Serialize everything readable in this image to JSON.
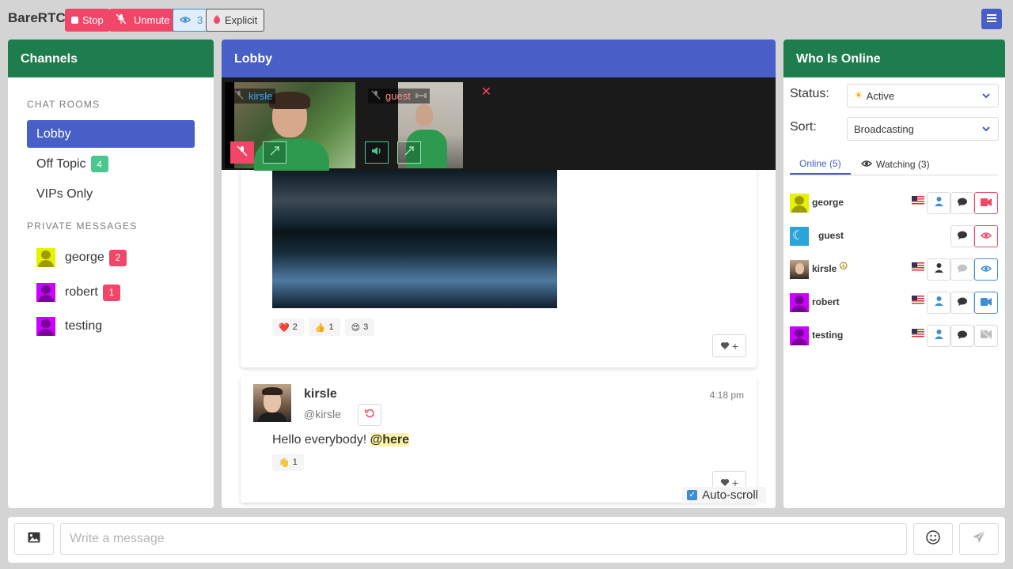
{
  "app": {
    "brand": "BareRTC",
    "stop_label": "Stop",
    "unmute_label": "Unmute",
    "watchers_count": "3",
    "explicit_label": "Explicit"
  },
  "channels": {
    "title": "Channels",
    "chat_rooms_label": "CHAT ROOMS",
    "rooms": [
      {
        "name": "Lobby",
        "badge": ""
      },
      {
        "name": "Off Topic",
        "badge": "4"
      },
      {
        "name": "VIPs Only",
        "badge": ""
      }
    ],
    "pm_label": "PRIVATE MESSAGES",
    "pms": [
      {
        "name": "george",
        "badge": "2"
      },
      {
        "name": "robert",
        "badge": "1"
      },
      {
        "name": "testing",
        "badge": ""
      }
    ]
  },
  "lobby": {
    "title": "Lobby",
    "videos": [
      {
        "name": "kirsle"
      },
      {
        "name": "guest"
      }
    ],
    "image_reactions": [
      {
        "emoji": "❤️",
        "count": "2"
      },
      {
        "emoji": "👍",
        "count": "1"
      },
      {
        "emoji": "😍",
        "count": "3"
      }
    ],
    "message": {
      "display_name": "kirsle",
      "username": "@kirsle",
      "time": "4:18 pm",
      "text": "Hello everybody! ",
      "mention": "@here",
      "reaction_emoji": "👋",
      "reaction_count": "1"
    },
    "autoscroll_label": "Auto-scroll"
  },
  "online": {
    "title": "Who Is Online",
    "status_label": "Status:",
    "status_value": "Active",
    "sort_label": "Sort:",
    "sort_value": "Broadcasting",
    "tab_online": "Online (5)",
    "tab_watching": "Watching (3)",
    "users": [
      {
        "name": "george"
      },
      {
        "name": "guest"
      },
      {
        "name": "kirsle"
      },
      {
        "name": "robert"
      },
      {
        "name": "testing"
      }
    ]
  },
  "composer": {
    "placeholder": "Write a message"
  },
  "colors": {
    "green_header": "#1d7d4d",
    "blue_header": "#485fc7",
    "danger": "#f14668",
    "info": "#3e8ed0",
    "badge_green": "#48c78e"
  },
  "icons": [
    "stop-icon",
    "mic-slash-icon",
    "eye-icon",
    "fire-icon",
    "hamburger-icon",
    "video-icon",
    "chat-icon",
    "user-icon",
    "image-icon",
    "smile-icon",
    "send-icon",
    "heart-icon",
    "plus-icon",
    "undo-icon",
    "peace-icon",
    "flag-us-icon",
    "moon-icon",
    "sun-icon",
    "chevron-down-icon",
    "close-icon",
    "expand-icon",
    "volume-icon",
    "dumbbell-icon"
  ]
}
